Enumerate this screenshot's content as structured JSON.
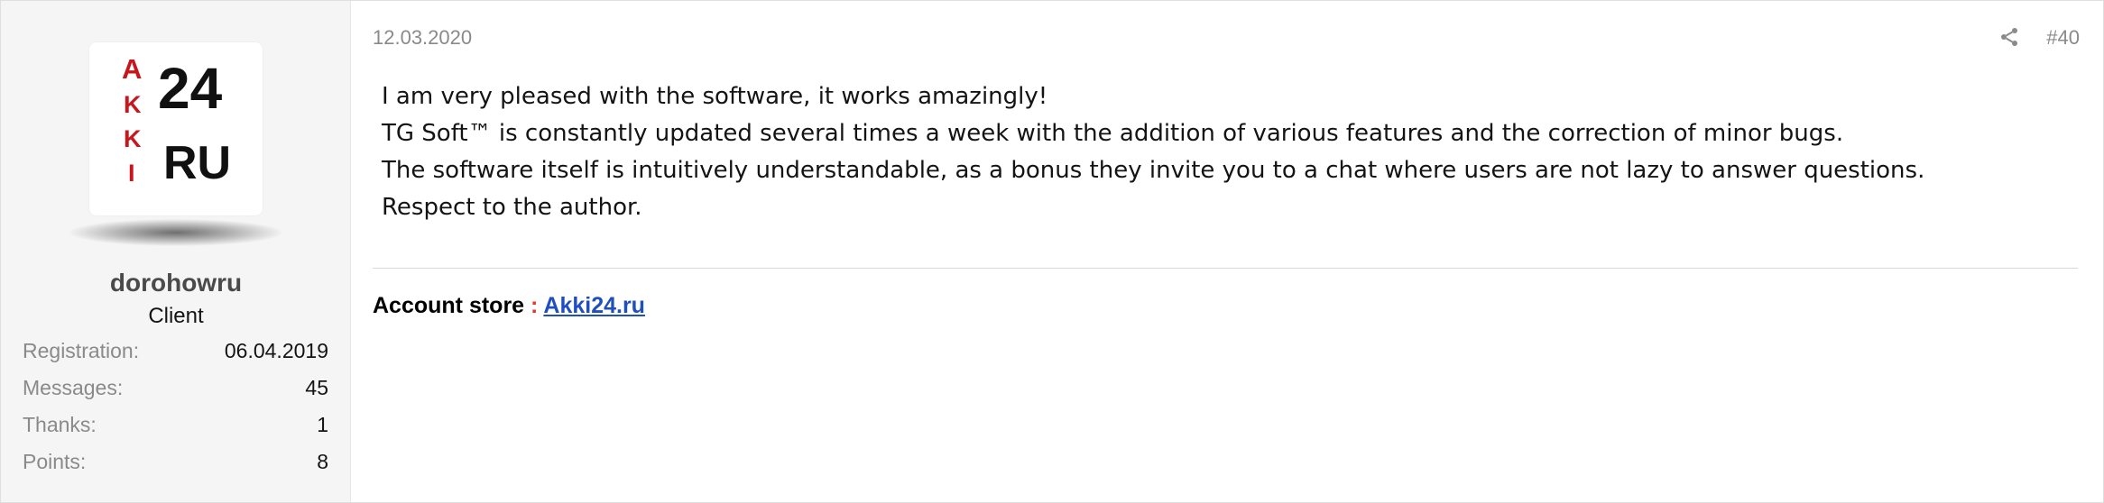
{
  "user": {
    "avatar": {
      "text_letters": [
        "A",
        "K",
        "K",
        "I"
      ],
      "text_24": "24",
      "text_ru": "RU",
      "colors": {
        "letters": "#c8161d",
        "digits": "#111111"
      }
    },
    "name": "dorohowru",
    "title": "Client",
    "stats": [
      {
        "label": "Registration:",
        "value": "06.04.2019"
      },
      {
        "label": "Messages:",
        "value": "45"
      },
      {
        "label": "Thanks:",
        "value": "1"
      },
      {
        "label": "Points:",
        "value": "8"
      }
    ]
  },
  "post": {
    "date": "12.03.2020",
    "number": "#40",
    "share_icon": "share-icon",
    "lines": [
      "I am very pleased with the software, it works amazingly!",
      "TG Soft™ is constantly updated several times a week with the addition of various features and the correction of minor bugs.",
      "The software itself is intuitively understandable, as a bonus they invite you to a chat where users are not lazy to answer questions.",
      "Respect to the author."
    ]
  },
  "signature": {
    "label": "Account store",
    "separator": " : ",
    "link_text": "Akki24.ru"
  },
  "colors": {
    "link": "#1f4fbf",
    "accent_red": "#e8352a",
    "muted": "#8a8a8a",
    "sidebar_bg": "#f5f5f5"
  }
}
